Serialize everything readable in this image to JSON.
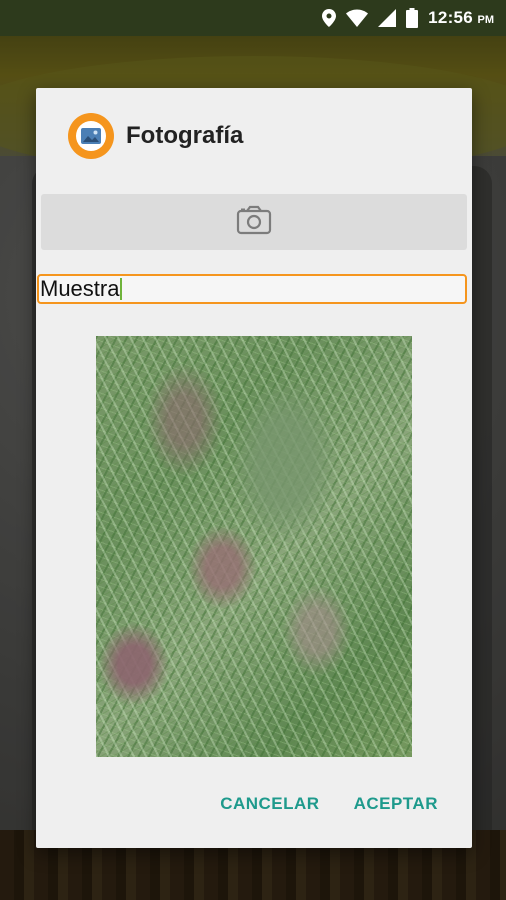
{
  "status_bar": {
    "time": "12:56",
    "ampm": "PM",
    "icons": [
      "location-icon",
      "wifi-icon",
      "signal-icon",
      "battery-icon"
    ]
  },
  "dialog": {
    "title": "Fotografía",
    "app_icon": "image-icon",
    "camera_button_icon": "camera-icon",
    "name_input": {
      "value": "Muestra"
    },
    "photo_description_icon": "photo-preview",
    "actions": {
      "cancel_label": "CANCELAR",
      "accept_label": "ACEPTAR"
    }
  },
  "colors": {
    "accent": "#f5951d",
    "button_text": "#1e9a8c",
    "status_bar": "#2d3a1c"
  }
}
